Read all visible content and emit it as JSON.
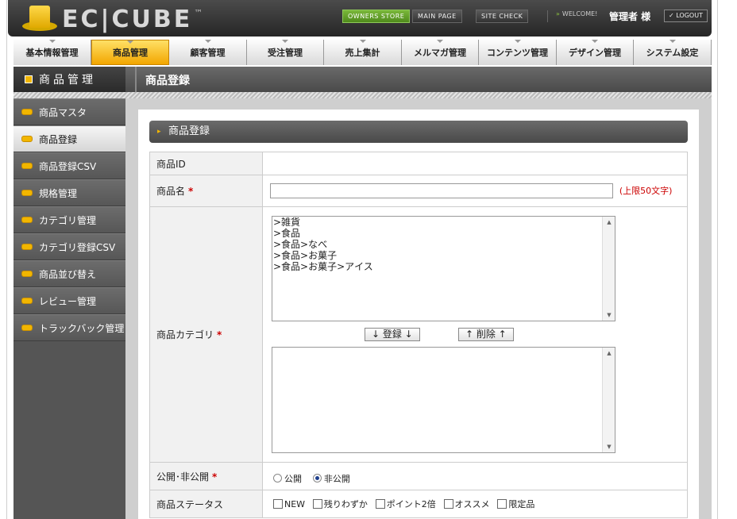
{
  "header": {
    "logo_text": "EC|CUBE",
    "logo_tm": "™",
    "owners_store": "OWNERS STORE",
    "main_page": "MAIN PAGE",
    "site_check": "SITE CHECK",
    "welcome": "WELCOME!",
    "admin_name": "管理者 様",
    "logout": "LOGOUT"
  },
  "mainnav": [
    {
      "label": "基本情報管理"
    },
    {
      "label": "商品管理",
      "active": true
    },
    {
      "label": "顧客管理"
    },
    {
      "label": "受注管理"
    },
    {
      "label": "売上集計"
    },
    {
      "label": "メルマガ管理"
    },
    {
      "label": "コンテンツ管理"
    },
    {
      "label": "デザイン管理"
    },
    {
      "label": "システム設定"
    }
  ],
  "section": {
    "sidebar_title": "商品管理",
    "page_title": "商品登録"
  },
  "sidebar": [
    {
      "label": "商品マスタ"
    },
    {
      "label": "商品登録",
      "active": true
    },
    {
      "label": "商品登録CSV"
    },
    {
      "label": "規格管理"
    },
    {
      "label": "カテゴリ管理"
    },
    {
      "label": "カテゴリ登録CSV"
    },
    {
      "label": "商品並び替え"
    },
    {
      "label": "レビュー管理"
    },
    {
      "label": "トラックバック管理"
    }
  ],
  "panel": {
    "title": "商品登録"
  },
  "form": {
    "product_id_label": "商品ID",
    "product_id_value": "",
    "product_name_label": "商品名",
    "product_name_value": "",
    "product_name_limit": "(上限50文字)",
    "category_label": "商品カテゴリ",
    "category_options": [
      ">雑貨",
      ">食品",
      ">食品>なべ",
      ">食品>お菓子",
      ">食品>お菓子>アイス"
    ],
    "register_button": "↓ 登録 ↓",
    "delete_button": "↑ 削除 ↑",
    "publish_label": "公開･非公開",
    "publish_on": "公開",
    "publish_off": "非公開",
    "publish_selected": "非公開",
    "status_label": "商品ステータス",
    "status_options": [
      "NEW",
      "残りわずか",
      "ポイント2倍",
      "オススメ",
      "限定品"
    ],
    "required_mark": "*"
  },
  "colors": {
    "accent_yellow": "#f2b600",
    "required_red": "#cc0000",
    "owners_green": "#6aa52c"
  }
}
